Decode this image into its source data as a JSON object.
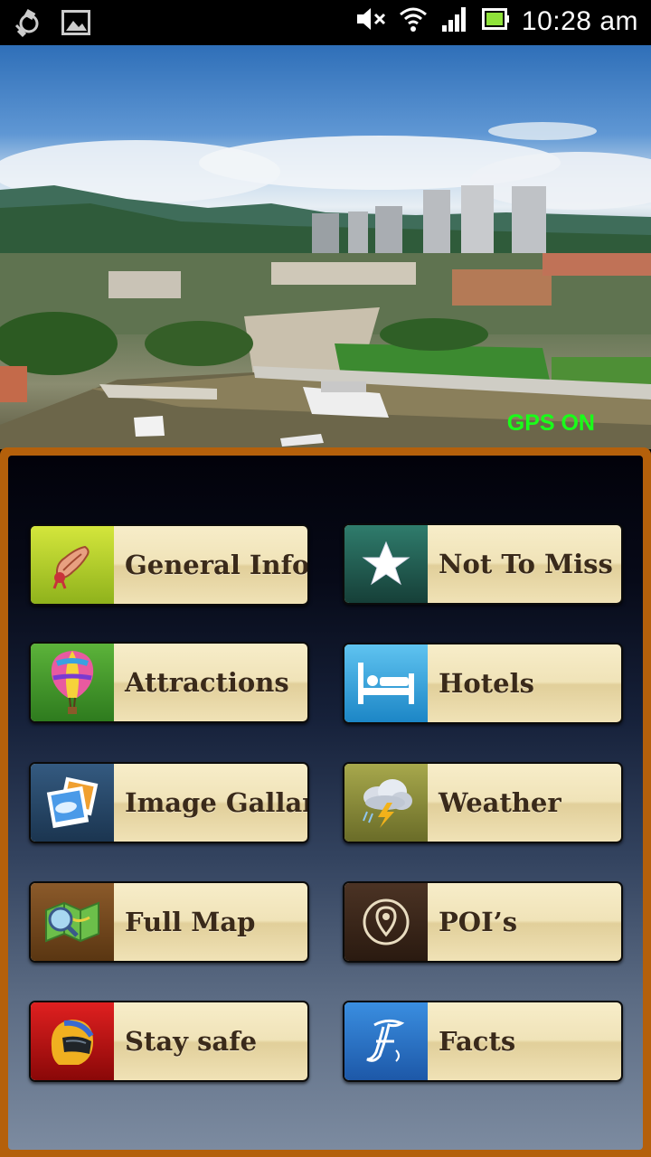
{
  "status_bar": {
    "time": "10:28 am",
    "icons": [
      "gps-sync-icon",
      "image-notification-icon",
      "mute-icon",
      "wifi-icon",
      "signal-icon",
      "battery-icon"
    ]
  },
  "hero": {
    "gps_status": "GPS ON",
    "gps_color": "#19ff19"
  },
  "menu": {
    "items": [
      {
        "label": "General Info",
        "icon": "scroll-icon"
      },
      {
        "label": "Not To Miss",
        "icon": "star-icon"
      },
      {
        "label": "Attractions",
        "icon": "hot-air-balloon-icon"
      },
      {
        "label": "Hotels",
        "icon": "bed-icon"
      },
      {
        "label": "Image Gallary",
        "icon": "photos-icon"
      },
      {
        "label": "Weather",
        "icon": "storm-cloud-icon"
      },
      {
        "label": "Full Map",
        "icon": "map-icon"
      },
      {
        "label": "POI’s",
        "icon": "location-pin-icon"
      },
      {
        "label": "Stay safe",
        "icon": "helmet-icon"
      },
      {
        "label": "Facts",
        "icon": "letter-f-icon"
      }
    ]
  },
  "colors": {
    "panel_border": "#b4600b",
    "button_face": "#f0e3b8",
    "label_text": "#3a2a1a"
  }
}
